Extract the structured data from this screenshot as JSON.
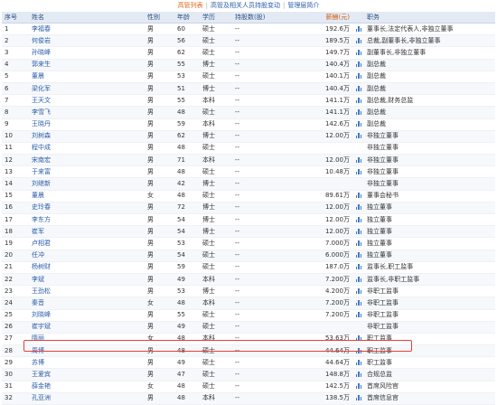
{
  "tabs": [
    "高管列表",
    "高管及相关人员持股变动",
    "管理层简介"
  ],
  "tab_separator": "|",
  "columns": [
    "序号",
    "姓名",
    "性别",
    "年龄",
    "学历",
    "持股数(股)",
    "薪酬(元)",
    "",
    "职务"
  ],
  "rows": [
    [
      "1",
      "李福春",
      "男",
      "60",
      "硕士",
      "--",
      "192.6万",
      "chart",
      "董事长,法定代表人,非独立董事"
    ],
    [
      "2",
      "何俊岩",
      "男",
      "56",
      "硕士",
      "--",
      "189.5万",
      "chart",
      "总裁,副董事长,非独立董事"
    ],
    [
      "3",
      "孙晓峰",
      "男",
      "62",
      "硕士",
      "--",
      "149.7万",
      "chart",
      "副董事长,非独立董事"
    ],
    [
      "4",
      "郭来生",
      "男",
      "55",
      "博士",
      "--",
      "140.4万",
      "chart",
      "副总裁"
    ],
    [
      "5",
      "董晨",
      "男",
      "53",
      "硕士",
      "--",
      "140.1万",
      "chart",
      "副总裁"
    ],
    [
      "6",
      "梁化军",
      "男",
      "51",
      "博士",
      "--",
      "140.4万",
      "chart",
      "副总裁"
    ],
    [
      "7",
      "王天文",
      "男",
      "55",
      "本科",
      "--",
      "141.1万",
      "chart",
      "副总裁,财务总监"
    ],
    [
      "8",
      "李雪飞",
      "男",
      "48",
      "硕士",
      "--",
      "141.1万",
      "chart",
      "副总裁"
    ],
    [
      "9",
      "王晓丹",
      "男",
      "59",
      "本科",
      "--",
      "142.6万",
      "chart",
      "副总裁"
    ],
    [
      "10",
      "刘树森",
      "男",
      "62",
      "博士",
      "--",
      "12.00万",
      "chart",
      "非独立董事"
    ],
    [
      "11",
      "程中成",
      "男",
      "48",
      "硕士",
      "--",
      "",
      "",
      "非独立董事"
    ],
    [
      "12",
      "宋南宏",
      "男",
      "71",
      "本科",
      "--",
      "12.00万",
      "chart",
      "非独立董事"
    ],
    [
      "13",
      "于来富",
      "男",
      "48",
      "硕士",
      "--",
      "10.48万",
      "chart",
      "非独立董事"
    ],
    [
      "14",
      "刘继新",
      "男",
      "42",
      "博士",
      "--",
      "",
      "",
      "非独立董事"
    ],
    [
      "15",
      "董晨",
      "女",
      "48",
      "硕士",
      "--",
      "89.61万",
      "chart",
      "董事会秘书"
    ],
    [
      "16",
      "史玲春",
      "男",
      "72",
      "博士",
      "--",
      "12.00万",
      "chart",
      "独立董事"
    ],
    [
      "17",
      "李东方",
      "男",
      "54",
      "博士",
      "--",
      "12.00万",
      "chart",
      "独立董事"
    ],
    [
      "18",
      "崔军",
      "男",
      "54",
      "博士",
      "--",
      "12.00万",
      "chart",
      "独立董事"
    ],
    [
      "19",
      "卢相君",
      "男",
      "53",
      "硕士",
      "--",
      "7.000万",
      "chart",
      "独立董事"
    ],
    [
      "20",
      "任冲",
      "男",
      "54",
      "硕士",
      "--",
      "6.000万",
      "chart",
      "独立董事"
    ],
    [
      "21",
      "杨树财",
      "男",
      "59",
      "硕士",
      "--",
      "187.0万",
      "chart",
      "监事长,职工监事"
    ],
    [
      "22",
      "李斌",
      "男",
      "49",
      "本科",
      "--",
      "7.200万",
      "chart",
      "监事长,非职工监事"
    ],
    [
      "23",
      "王劲松",
      "男",
      "53",
      "博士",
      "--",
      "4.200万",
      "chart",
      "非职工监事"
    ],
    [
      "24",
      "秦音",
      "女",
      "48",
      "本科",
      "--",
      "7.200万",
      "chart",
      "非职工监事"
    ],
    [
      "25",
      "刘晓峰",
      "男",
      "55",
      "硕士",
      "--",
      "7.200万",
      "chart",
      "非职工监事"
    ],
    [
      "26",
      "崔宇斌",
      "男",
      "49",
      "硕士",
      "--",
      "",
      "",
      "非职工监事"
    ],
    [
      "27",
      "隋丽",
      "女",
      "48",
      "本科",
      "--",
      "53.63万",
      "chart",
      "职工监事"
    ],
    [
      "28",
      "周博",
      "男",
      "48",
      "硕士",
      "--",
      "44.64万",
      "chart",
      "职工监事"
    ],
    [
      "29",
      "苏博",
      "男",
      "49",
      "硕士",
      "--",
      "44.64万",
      "chart",
      "职工监事"
    ],
    [
      "30",
      "王爱宾",
      "男",
      "47",
      "硕士",
      "--",
      "148.8万",
      "chart",
      "合规总监"
    ],
    [
      "31",
      "薛金艳",
      "女",
      "48",
      "硕士",
      "--",
      "142.5万",
      "chart",
      "首席风险官"
    ],
    [
      "32",
      "孔亚洲",
      "男",
      "48",
      "本科",
      "--",
      "138.5万",
      "chart",
      "首席信息官"
    ]
  ],
  "highlighted_row": "30",
  "highlight_color": "#e4403c",
  "chart_icon": "bar-chart-icon"
}
